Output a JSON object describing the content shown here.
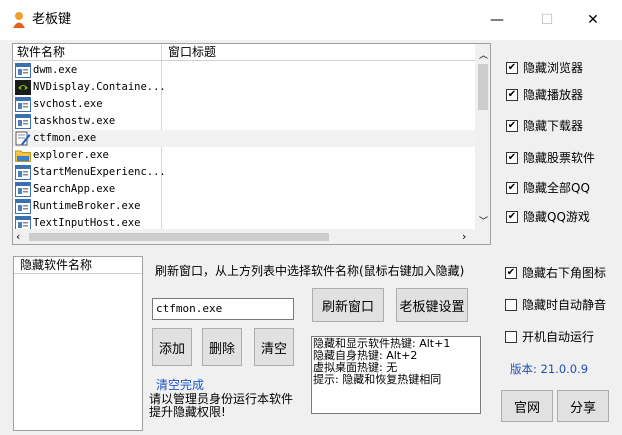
{
  "window": {
    "title": "老板键",
    "controls": {
      "minimize": "—",
      "maximize": "☐",
      "close": "✕"
    }
  },
  "process_list": {
    "columns": [
      "软件名称",
      "窗口标题"
    ],
    "rows": [
      {
        "name": "dwm.exe",
        "title": "",
        "icon": "window-app-icon"
      },
      {
        "name": "NVDisplay.Containe...",
        "title": "",
        "icon": "nvidia-icon"
      },
      {
        "name": "svchost.exe",
        "title": "",
        "icon": "window-app-icon"
      },
      {
        "name": "taskhostw.exe",
        "title": "",
        "icon": "window-app-icon"
      },
      {
        "name": "ctfmon.exe",
        "title": "",
        "icon": "notepad-pen-icon"
      },
      {
        "name": "explorer.exe",
        "title": "",
        "icon": "folder-icon"
      },
      {
        "name": "StartMenuExperienc...",
        "title": "",
        "icon": "window-app-icon"
      },
      {
        "name": "SearchApp.exe",
        "title": "",
        "icon": "window-app-icon"
      },
      {
        "name": "RuntimeBroker.exe",
        "title": "",
        "icon": "window-app-icon"
      },
      {
        "name": "TextInputHost.exe",
        "title": "",
        "icon": "window-app-icon"
      }
    ],
    "selected_index": 4
  },
  "hidden_list": {
    "column": "隐藏软件名称",
    "rows": []
  },
  "hint": "刷新窗口，从上方列表中选择软件名称(鼠标右键加入隐藏)",
  "input": {
    "value": "ctfmon.exe"
  },
  "buttons": {
    "refresh": "刷新窗口",
    "settings": "老板键设置",
    "add": "添加",
    "delete": "删除",
    "clear": "清空",
    "website": "官网",
    "share": "分享"
  },
  "status": "清空完成",
  "admin_notice": "请以管理员身份运行本软件\n提升隐藏权限!",
  "hotkeys": [
    "隐藏和显示软件热键: Alt+1",
    "隐藏自身热键: Alt+2",
    "虚拟桌面热键: 无",
    "提示: 隐藏和恢复热键相同"
  ],
  "options": [
    {
      "label": "隐藏浏览器",
      "checked": true
    },
    {
      "label": "隐藏播放器",
      "checked": true
    },
    {
      "label": "隐藏下载器",
      "checked": true
    },
    {
      "label": "隐藏股票软件",
      "checked": true
    },
    {
      "label": "隐藏全部QQ",
      "checked": true
    },
    {
      "label": "隐藏QQ游戏",
      "checked": true
    }
  ],
  "options2": [
    {
      "label": "隐藏右下角图标",
      "checked": true
    },
    {
      "label": "隐藏时自动静音",
      "checked": false
    },
    {
      "label": "开机自动运行",
      "checked": false
    }
  ],
  "version": "版本: 21.0.0.9",
  "colors": {
    "version_text": "#1f4fb4",
    "status_text": "#1a56c9"
  }
}
